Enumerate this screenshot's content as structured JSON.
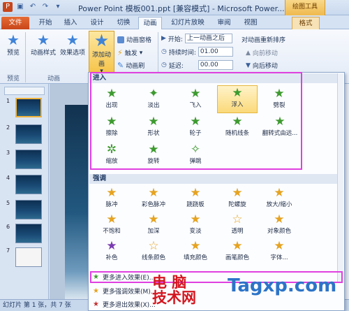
{
  "titlebar": {
    "title": "Power Point  模板001.ppt [兼容模式] - Microsoft Power...",
    "context_tool": "绘图工具",
    "qat_icons": [
      "ppt-app-icon",
      "save-icon",
      "undo-icon",
      "redo-icon",
      "customize-qat-icon"
    ]
  },
  "tabs": [
    "文件",
    "开始",
    "插入",
    "设计",
    "切换",
    "动画",
    "幻灯片放映",
    "审阅",
    "视图",
    "格式"
  ],
  "ribbon": {
    "preview_label": "预览",
    "animation_style_label": "动画样式",
    "effect_options_label": "效果选项",
    "add_animation_label": "添加动画",
    "animation_pane_label": "动画窗格",
    "trigger_label": "触发",
    "animation_painter_label": "动画刷",
    "start_label": "开始:",
    "start_value": "上一动画之后",
    "duration_label": "持续时间:",
    "duration_value": "01.00",
    "delay_label": "延迟:",
    "delay_value": "00.00",
    "reorder_label": "对动画重新排序",
    "move_earlier_label": "向前移动",
    "move_later_label": "向后移动",
    "group_preview": "预览",
    "group_animation": "动画"
  },
  "slides": [
    "1",
    "2",
    "3",
    "4",
    "5",
    "6",
    "7"
  ],
  "gallery": {
    "entrance_header": "进入",
    "entrance": [
      "出现",
      "淡出",
      "飞入",
      "浮入",
      "劈裂",
      "擦除",
      "形状",
      "轮子",
      "随机线条",
      "翻转式由远...",
      "缩放",
      "旋转",
      "弹跳"
    ],
    "emphasis_header": "强调",
    "emphasis": [
      "脉冲",
      "彩色脉冲",
      "跷跷板",
      "陀螺旋",
      "放大/缩小",
      "不饱和",
      "加深",
      "变淡",
      "透明",
      "对象颜色",
      "补色",
      "线条颜色",
      "填充颜色",
      "画笔颜色",
      "字体..."
    ],
    "more_entrance": "更多进入效果(E)...",
    "more_emphasis": "更多强调效果(M)...",
    "more_exit": "更多退出效果(X)..."
  },
  "status": {
    "text": "幻灯片 第 1 张，共 7 张"
  },
  "watermark": {
    "line1": "电 脑",
    "line2": "技术网",
    "brand": "Tagxp.com"
  }
}
